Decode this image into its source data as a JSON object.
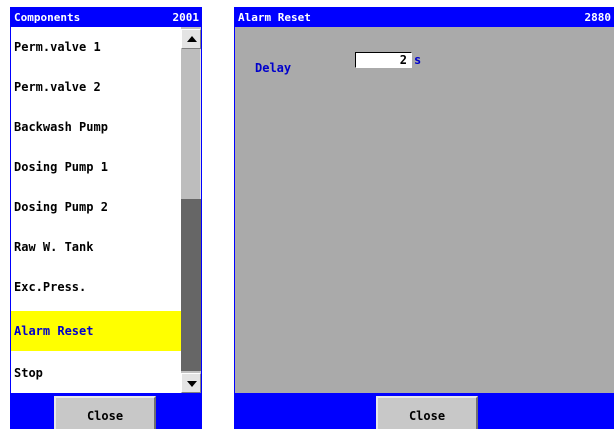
{
  "left_panel": {
    "title": "Components",
    "id": "2001",
    "items": [
      {
        "label": "Perm.valve 1"
      },
      {
        "label": "Perm.valve 2"
      },
      {
        "label": "Backwash Pump"
      },
      {
        "label": "Dosing Pump 1"
      },
      {
        "label": "Dosing Pump 2"
      },
      {
        "label": "Raw W. Tank"
      },
      {
        "label": "Exc.Press."
      },
      {
        "label": "Alarm Reset"
      },
      {
        "label": "Stop"
      }
    ],
    "selected_index": 7,
    "close_label": "Close"
  },
  "right_panel": {
    "title": "Alarm Reset",
    "id": "2880",
    "delay_label": "Delay",
    "delay_value": "2",
    "delay_unit": "s",
    "close_label": "Close"
  },
  "colors": {
    "panel_blue": "#0000ff",
    "selection_yellow": "#ffff00",
    "content_gray": "#aaaaaa",
    "label_blue": "#0000cc"
  },
  "icons": {
    "scroll_up": "triangle-up-icon",
    "scroll_down": "triangle-down-icon"
  }
}
